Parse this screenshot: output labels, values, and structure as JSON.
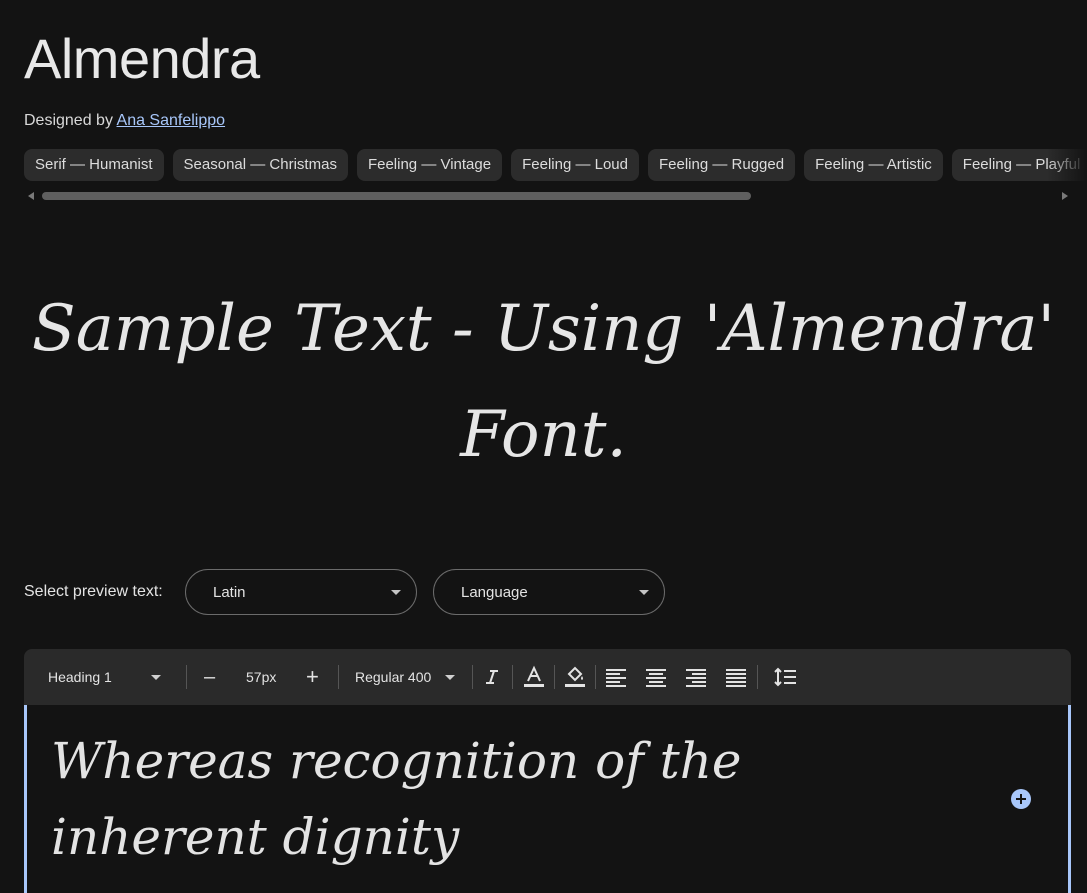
{
  "font": {
    "name": "Almendra",
    "designed_by_prefix": "Designed by",
    "designer": "Ana Sanfelippo"
  },
  "tags": [
    "Serif — Humanist",
    "Seasonal — Christmas",
    "Feeling — Vintage",
    "Feeling — Loud",
    "Feeling — Rugged",
    "Feeling — Artistic",
    "Feeling — Playful"
  ],
  "sample_text": {
    "line1": "Sample Text - Using 'Almendra'",
    "line2": "Font."
  },
  "preview": {
    "label": "Select preview text:",
    "script_select": "Latin",
    "language_select": "Language"
  },
  "toolbar": {
    "block_style": "Heading 1",
    "decrease_label": "–",
    "font_size": "57px",
    "increase_label": "+",
    "weight": "Regular 400"
  },
  "editor": {
    "text": "Whereas recognition of the inherent dignity"
  },
  "colors": {
    "background": "#131313",
    "chip": "#2c2c2c",
    "link": "#a8c7fa",
    "toolbar": "#2a2a2a",
    "focus_border": "#a8c7fa"
  }
}
